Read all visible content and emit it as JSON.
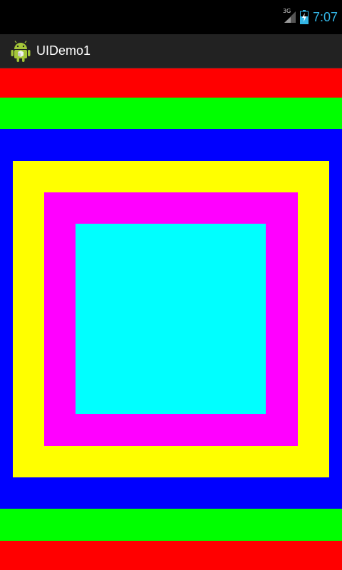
{
  "status_bar": {
    "network_type": "3G",
    "time": "7:07",
    "icons": [
      "signal-icon",
      "battery-charging-icon"
    ]
  },
  "action_bar": {
    "title": "UIDemo1",
    "icon": "android-app-icon"
  },
  "colors": {
    "red": "#ff0000",
    "green": "#00ff00",
    "blue": "#0000ff",
    "yellow": "#ffff00",
    "magenta": "#ff00ff",
    "cyan": "#00ffff",
    "clock": "#33b5e5"
  }
}
